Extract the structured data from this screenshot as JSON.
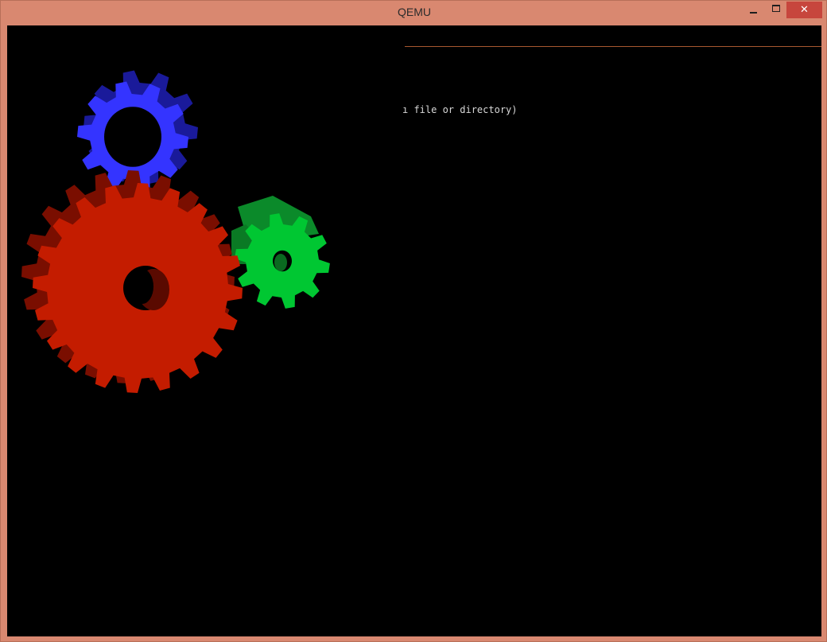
{
  "window": {
    "title": "QEMU",
    "controls": {
      "minimize_icon": "minimize-icon",
      "maximize_icon": "maximize-icon",
      "close_icon": "close-icon",
      "close_glyph": "✕"
    }
  },
  "console": {
    "visible_text": "ı file or directory)"
  },
  "colors": {
    "frame": "#d98870",
    "close_button": "#c7463d",
    "screen": "#000000",
    "console_rule": "#a8572f",
    "gear_red": "#c41c00",
    "gear_green": "#00c732",
    "gear_blue": "#3434ff"
  }
}
